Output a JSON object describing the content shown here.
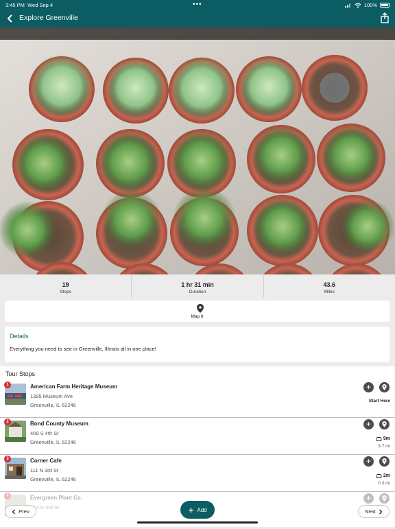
{
  "status_bar": {
    "time": "3:45 PM",
    "date": "Wed Sep 4",
    "battery": "100%"
  },
  "header": {
    "title": "Explore Greenville",
    "back_icon": "chevron-left-icon",
    "share_icon": "share-icon",
    "color": "#0b5d63"
  },
  "stats": [
    {
      "value": "19",
      "label": "Stops"
    },
    {
      "value": "1 hr 31 min",
      "label": "Duration"
    },
    {
      "value": "43.6",
      "label": "Miles"
    }
  ],
  "map_it": {
    "label": "Map It",
    "icon": "map-pin-icon"
  },
  "details": {
    "heading": "Details",
    "text": "Everything you need to see in Greenville, Illinois all in one place!"
  },
  "tour_stops": {
    "heading": "Tour Stops",
    "items": [
      {
        "number": "1",
        "name": "American Farm Heritage Museum",
        "address": "1395 Museum Ave",
        "city": "Greenville, IL 62246",
        "note": "Start Here"
      },
      {
        "number": "2",
        "name": "Bond County Museum",
        "address": "409 S 4th St",
        "city": "Greenville, IL 62246",
        "drive_time": "9m",
        "distance": "3.7 mi"
      },
      {
        "number": "3",
        "name": "Corner Cafe",
        "address": "111 N 3rd St",
        "city": "Greenville, IL 62246",
        "drive_time": "2m",
        "distance": "0.3 mi"
      },
      {
        "number": "4",
        "name": "Evergreen Plant Co.",
        "address": "314 N 3rd St"
      }
    ]
  },
  "footer": {
    "prev_label": "Prev",
    "add_label": "Add",
    "next_label": "Next"
  }
}
